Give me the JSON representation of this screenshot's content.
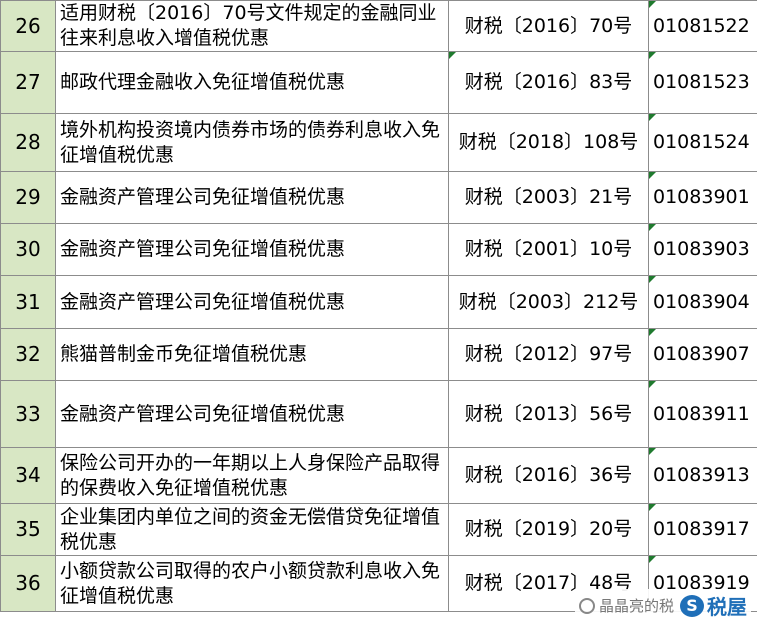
{
  "rows": [
    {
      "num": "26",
      "name": "适用财税〔2016〕70号文件规定的金融同业往来利息收入增值税优惠",
      "doc": "财税〔2016〕70号",
      "code": "01081522"
    },
    {
      "num": "27",
      "name": "邮政代理金融收入免征增值税优惠",
      "doc": "财税〔2016〕83号",
      "code": "01081523"
    },
    {
      "num": "28",
      "name": "境外机构投资境内债券市场的债券利息收入免征增值税优惠",
      "doc": "财税〔2018〕108号",
      "code": "01081524"
    },
    {
      "num": "29",
      "name": "金融资产管理公司免征增值税优惠",
      "doc": "财税〔2003〕21号",
      "code": "01083901"
    },
    {
      "num": "30",
      "name": "金融资产管理公司免征增值税优惠",
      "doc": "财税〔2001〕10号",
      "code": "01083903"
    },
    {
      "num": "31",
      "name": "金融资产管理公司免征增值税优惠",
      "doc": "财税〔2003〕212号",
      "code": "01083904"
    },
    {
      "num": "32",
      "name": "熊猫普制金币免征增值税优惠",
      "doc": "财税〔2012〕97号",
      "code": "01083907"
    },
    {
      "num": "33",
      "name": "金融资产管理公司免征增值税优惠",
      "doc": "财税〔2013〕56号",
      "code": "01083911"
    },
    {
      "num": "34",
      "name": "保险公司开办的一年期以上人身保险产品取得的保费收入免征增值税优惠",
      "doc": "财税〔2016〕36号",
      "code": "01083913"
    },
    {
      "num": "35",
      "name": "企业集团内单位之间的资金无偿借贷免征增值税优惠",
      "doc": "财税〔2019〕20号",
      "code": "01083917"
    },
    {
      "num": "36",
      "name": "小额贷款公司取得的农户小额贷款利息收入免征增值税优惠",
      "doc": "财税〔2017〕48号",
      "code": "01083919"
    }
  ],
  "watermark": {
    "text": "晶晶亮的税",
    "logo_letter": "S",
    "logo_text": "税屋"
  },
  "colors": {
    "number_column_bg": "#d8e7c4",
    "border": "#8c8c8c",
    "cell_marker": "#1f7a2e",
    "logo_blue": "#1f6fb8"
  }
}
